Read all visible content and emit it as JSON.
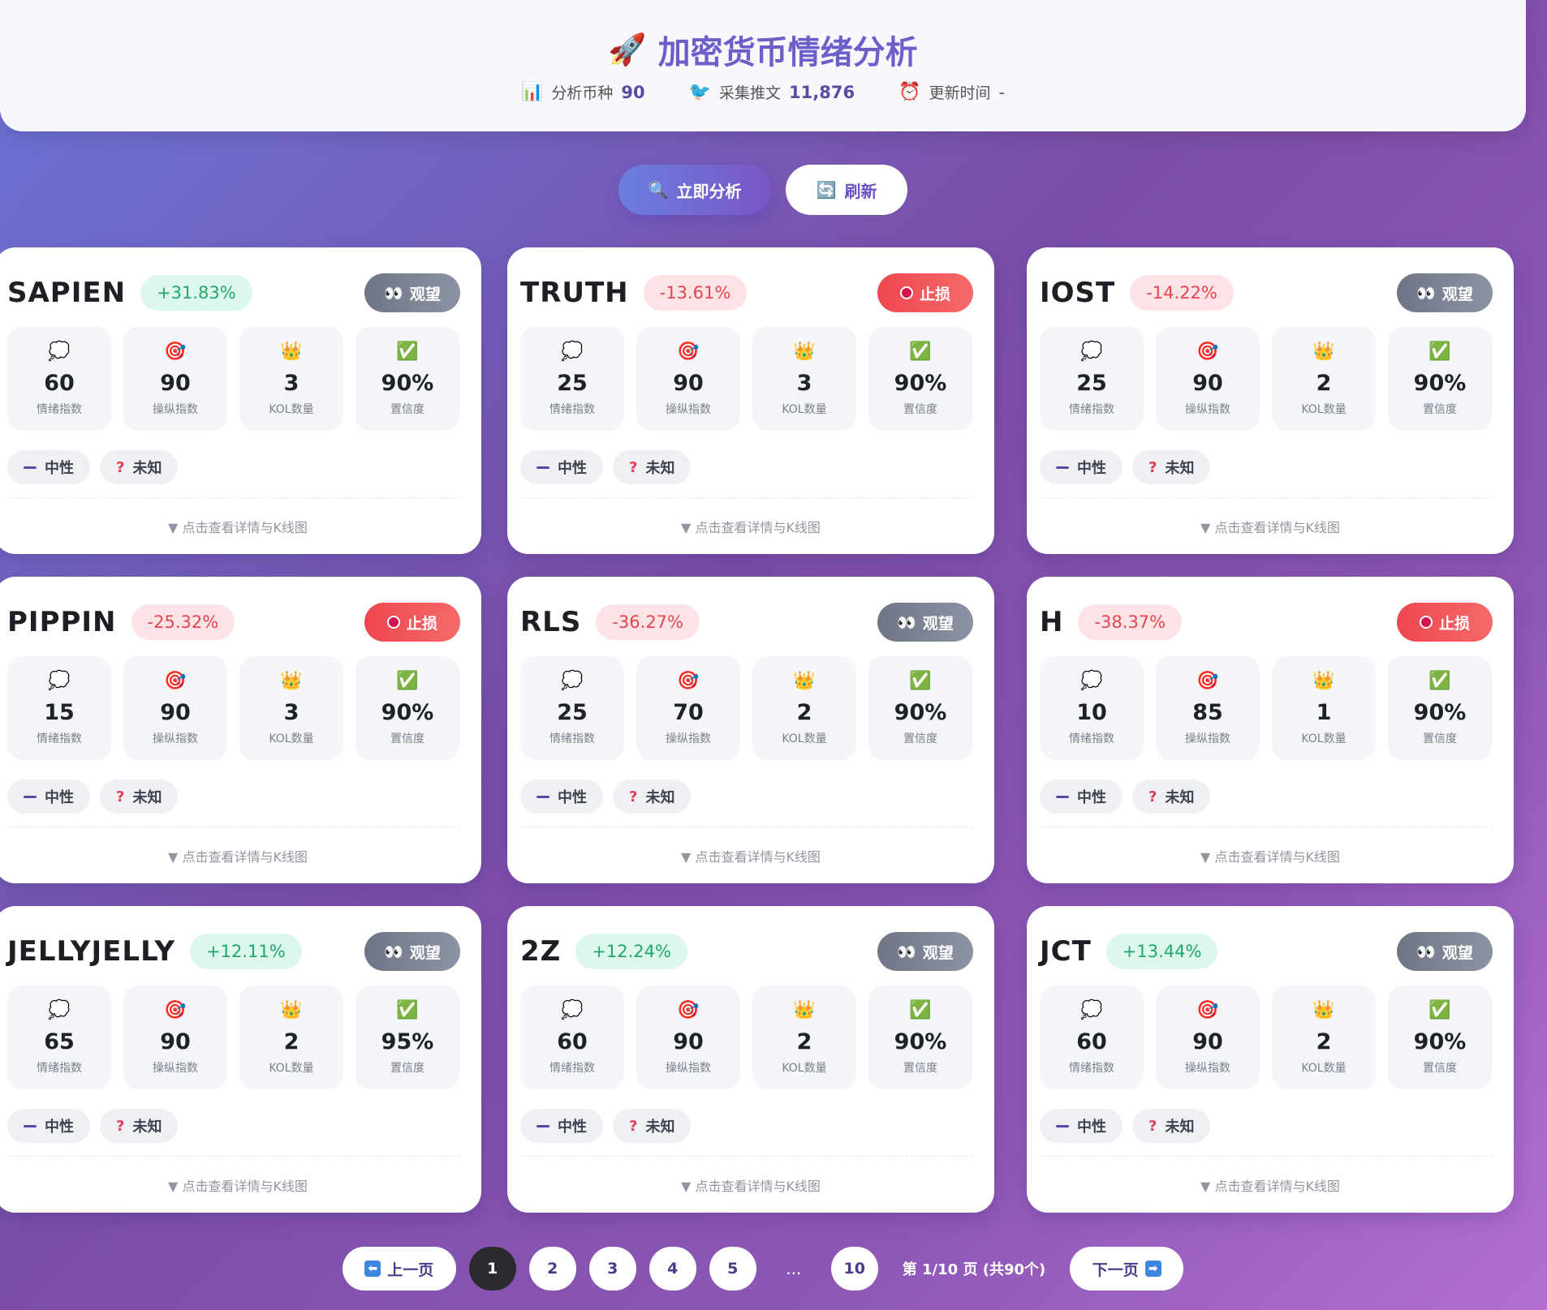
{
  "header": {
    "title": "加密货币情绪分析",
    "stats": [
      {
        "icon": "bar-chart",
        "label": "分析币种",
        "value": "90"
      },
      {
        "icon": "bird",
        "label": "采集推文",
        "value": "11,876"
      },
      {
        "icon": "alarm-clock",
        "label": "更新时间",
        "value": "-"
      }
    ]
  },
  "actions": {
    "analyze_label": "立即分析",
    "refresh_label": "刷新"
  },
  "cards": [
    {
      "symbol": "SAPIEN",
      "change": "+31.83%",
      "dir": "up",
      "tag": "观望",
      "tag_type": "watch",
      "sentiment": "60",
      "manipulation": "90",
      "kol": "3",
      "confidence": "90%"
    },
    {
      "symbol": "TRUTH",
      "change": "-13.61%",
      "dir": "down",
      "tag": "止损",
      "tag_type": "stop",
      "sentiment": "25",
      "manipulation": "90",
      "kol": "3",
      "confidence": "90%"
    },
    {
      "symbol": "IOST",
      "change": "-14.22%",
      "dir": "down",
      "tag": "观望",
      "tag_type": "watch",
      "sentiment": "25",
      "manipulation": "90",
      "kol": "2",
      "confidence": "90%"
    },
    {
      "symbol": "PIPPIN",
      "change": "-25.32%",
      "dir": "down",
      "tag": "止损",
      "tag_type": "stop",
      "sentiment": "15",
      "manipulation": "90",
      "kol": "3",
      "confidence": "90%"
    },
    {
      "symbol": "RLS",
      "change": "-36.27%",
      "dir": "down",
      "tag": "观望",
      "tag_type": "watch",
      "sentiment": "25",
      "manipulation": "70",
      "kol": "2",
      "confidence": "90%"
    },
    {
      "symbol": "H",
      "change": "-38.37%",
      "dir": "down",
      "tag": "止损",
      "tag_type": "stop",
      "sentiment": "10",
      "manipulation": "85",
      "kol": "1",
      "confidence": "90%"
    },
    {
      "symbol": "JELLYJELLY",
      "change": "+12.11%",
      "dir": "up",
      "tag": "观望",
      "tag_type": "watch",
      "sentiment": "65",
      "manipulation": "90",
      "kol": "2",
      "confidence": "95%"
    },
    {
      "symbol": "2Z",
      "change": "+12.24%",
      "dir": "up",
      "tag": "观望",
      "tag_type": "watch",
      "sentiment": "60",
      "manipulation": "90",
      "kol": "2",
      "confidence": "90%"
    },
    {
      "symbol": "JCT",
      "change": "+13.44%",
      "dir": "up",
      "tag": "观望",
      "tag_type": "watch",
      "sentiment": "60",
      "manipulation": "90",
      "kol": "2",
      "confidence": "90%"
    }
  ],
  "card_labels": {
    "sentiment": "情绪指数",
    "manipulation": "操纵指数",
    "kol": "KOL数量",
    "confidence": "置信度",
    "pill_neutral": "中性",
    "pill_unknown": "未知",
    "detail": "点击查看详情与K线图"
  },
  "pagination": {
    "prev_label": "上一页",
    "next_label": "下一页",
    "pages": [
      "1",
      "2",
      "3",
      "4",
      "5"
    ],
    "ellipsis": "...",
    "last_page": "10",
    "current_page": "1",
    "info": "第 1/10 页 (共90个)"
  },
  "colors": {
    "accent": "#6d5fc9",
    "up": "#23a66b",
    "down": "#e44550",
    "watch_tag": "#7a808f",
    "stop_tag": "#f0505a"
  }
}
